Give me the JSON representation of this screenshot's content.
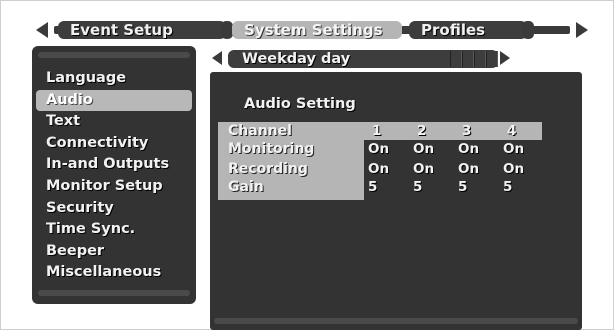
{
  "tabs": [
    {
      "label": "Event Setup"
    },
    {
      "label": "System Settings"
    },
    {
      "label": "Profiles"
    }
  ],
  "sidebar": {
    "items": [
      {
        "label": "Language"
      },
      {
        "label": "Audio"
      },
      {
        "label": "Text"
      },
      {
        "label": "Connectivity"
      },
      {
        "label": "In-and Outputs"
      },
      {
        "label": "Monitor Setup"
      },
      {
        "label": "Security"
      },
      {
        "label": "Time Sync."
      },
      {
        "label": "Beeper"
      },
      {
        "label": "Miscellaneous"
      }
    ],
    "selected": "Audio"
  },
  "subtab": {
    "label": "Weekday day"
  },
  "panel": {
    "title": "Audio Setting",
    "table": {
      "header": {
        "label": "Channel",
        "columns": [
          "1",
          "2",
          "3",
          "4"
        ]
      },
      "rows": [
        {
          "label": "Monitoring",
          "values": [
            "On",
            "On",
            "On",
            "On"
          ]
        },
        {
          "label": "Recording",
          "values": [
            "On",
            "On",
            "On",
            "On"
          ]
        },
        {
          "label": "Gain",
          "values": [
            "5",
            "5",
            "5",
            "5"
          ]
        }
      ]
    }
  }
}
